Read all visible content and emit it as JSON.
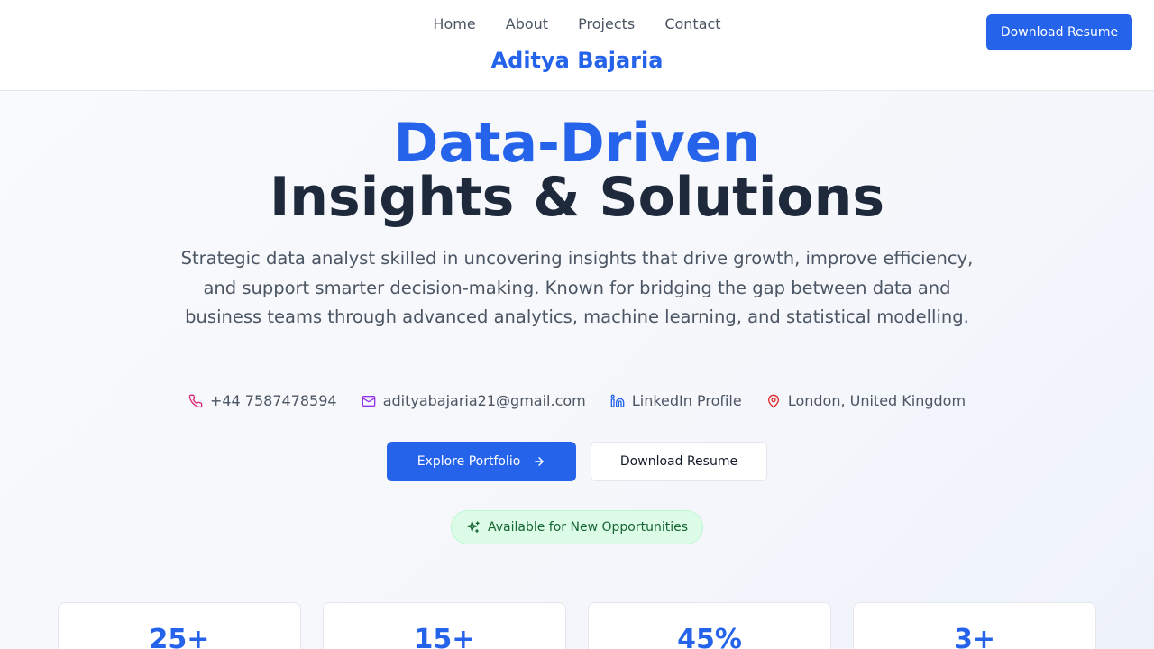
{
  "nav": {
    "items": [
      {
        "label": "Home"
      },
      {
        "label": "About"
      },
      {
        "label": "Projects"
      },
      {
        "label": "Contact"
      }
    ],
    "brand": "Aditya Bajaria",
    "resume_button": "Download Resume"
  },
  "hero": {
    "title_line1": "Data-Driven",
    "title_line2": "Insights & Solutions",
    "summary": "Strategic data analyst skilled in uncovering insights that drive growth, improve efficiency, and support smarter decision-making. Known for bridging the gap between data and business teams through advanced analytics, machine learning, and statistical modelling."
  },
  "contact": {
    "phone": "+44 7587478594",
    "email": "adityabajaria21@gmail.com",
    "linkedin": "LinkedIn Profile",
    "location": "London, United Kingdom"
  },
  "actions": {
    "explore": "Explore Portfolio",
    "download": "Download Resume"
  },
  "availability": "Available for New Opportunities",
  "stats": [
    {
      "value": "25+"
    },
    {
      "value": "15+"
    },
    {
      "value": "45%"
    },
    {
      "value": "3+"
    }
  ],
  "icons": {
    "phone": "phone-icon",
    "email": "mail-icon",
    "linkedin": "linkedin-icon",
    "location": "map-pin-icon",
    "arrow": "arrow-right-icon",
    "sparkle": "sparkles-icon"
  },
  "colors": {
    "accent": "#2563eb",
    "heading": "#1e293b",
    "badge_bg": "#dcfce7",
    "badge_text": "#166534",
    "phone_icon": "#db2777",
    "email_icon": "#9333ea",
    "location_icon": "#dc2626"
  }
}
